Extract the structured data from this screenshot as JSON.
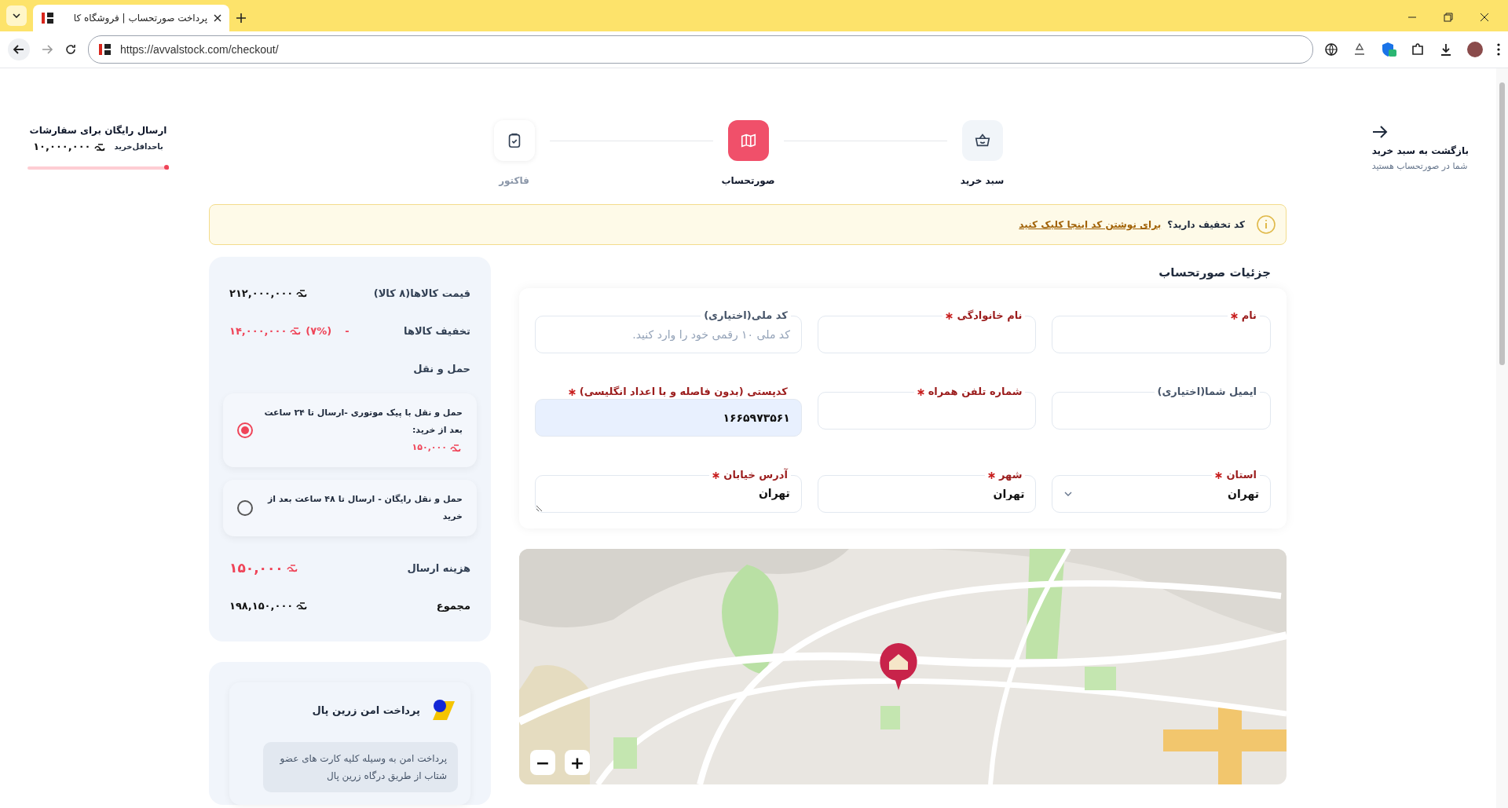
{
  "browser": {
    "tab_title": "پرداخت صورتحساب | فروشگاه کا",
    "url": "https://avvalstock.com/checkout/"
  },
  "header": {
    "back_title": "بازگشت به سبد خرید",
    "back_subtitle": "شما در صورتحساب هستید",
    "steps": [
      {
        "label": "سبد خرید",
        "selected": false,
        "disabled": false
      },
      {
        "label": "صورتحساب",
        "selected": true,
        "disabled": false
      },
      {
        "label": "فاکتور",
        "selected": false,
        "disabled": true
      }
    ],
    "free_shipping": {
      "title": "ارسال رایگان برای سفارشات",
      "caption": "باحداقل‌خرید",
      "amount": "۱۰,۰۰۰,۰۰۰",
      "level": 0.02
    }
  },
  "coupon": {
    "question": "کد تخفیف دارید؟",
    "link": "برای نوشتن کد اینجا کلیک کنید"
  },
  "summary": {
    "items_label": "قیمت کالاها(۸ کالا)",
    "items_price": "۲۱۲,۰۰۰,۰۰۰",
    "discount_label": "تخفیف کالاها",
    "discount_amount": "۱۴,۰۰۰,۰۰۰",
    "discount_percent": "(۷%)",
    "discount_sign": "-",
    "shipping_title": "حمل و نقل",
    "shipping_options": [
      {
        "label": "حمل و نقل با پیک موتوری -ارسال تا ۲۴ ساعت بعد از خرید:",
        "price": "۱۵۰,۰۰۰",
        "selected": true
      },
      {
        "label": "حمل و نقل رایگان - ارسال تا ۴۸ ساعت بعد از خرید",
        "selected": false
      }
    ],
    "shipping_cost_label": "هزینه ارسال",
    "shipping_cost": "۱۵۰,۰۰۰",
    "total_label": "مجموع",
    "total": "۱۹۸,۱۵۰,۰۰۰"
  },
  "payment": {
    "title": "پرداخت امن زرین پال",
    "description": "پرداخت امن به وسیله کلیه کارت های عضو شتاب از طریق درگاه زرین پال"
  },
  "billing": {
    "title": "جزئیات صورتحساب",
    "fields": [
      {
        "label": "نام",
        "required": true,
        "kind": "text"
      },
      {
        "label": "نام خانوادگی",
        "required": true,
        "kind": "text"
      },
      {
        "label": "کد ملی(اختیاری)",
        "required": false,
        "kind": "text",
        "placeholder": "کد ملی ۱۰ رقمی خود را وارد کنید."
      },
      {
        "label": "ایمیل شما(اختیاری)",
        "required": false,
        "kind": "text"
      },
      {
        "label": "شماره تلفن همراه",
        "required": true,
        "kind": "text"
      },
      {
        "label": "کدپستی (بدون فاصله و با اعداد انگلیسی)",
        "required": true,
        "kind": "text",
        "value": "۱۶۶۵۹۷۳۵۶۱",
        "autofilled": true
      },
      {
        "label": "استان",
        "required": true,
        "kind": "select",
        "value": "تهران"
      },
      {
        "label": "شهر",
        "required": true,
        "kind": "text",
        "value": "تهران"
      },
      {
        "label": "آدرس خیابان",
        "required": true,
        "kind": "textarea",
        "value": "تهران"
      }
    ]
  },
  "map": {
    "zoom_out": "−",
    "zoom_in": "+"
  }
}
